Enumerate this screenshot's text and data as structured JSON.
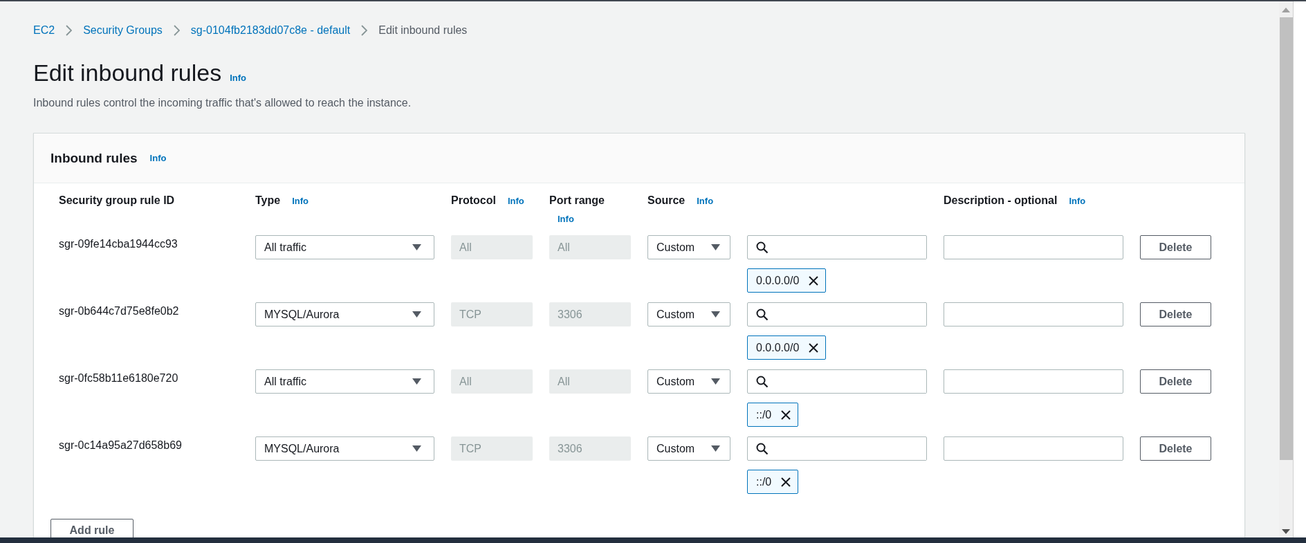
{
  "breadcrumb": [
    {
      "label": "EC2",
      "current": false
    },
    {
      "label": "Security Groups",
      "current": false
    },
    {
      "label": "sg-0104fb2183dd07c8e - default",
      "current": false
    },
    {
      "label": "Edit inbound rules",
      "current": true
    }
  ],
  "page": {
    "title": "Edit inbound rules",
    "info": "Info",
    "description": "Inbound rules control the incoming traffic that's allowed to reach the instance."
  },
  "panel": {
    "title": "Inbound rules",
    "info": "Info",
    "columns": [
      {
        "label": "Security group rule ID"
      },
      {
        "label": "Type",
        "info": "Info"
      },
      {
        "label": "Protocol",
        "info": "Info"
      },
      {
        "label": "Port range",
        "info": "Info",
        "info_below": true
      },
      {
        "label": "Source",
        "info": "Info"
      },
      {
        "label": "Description - optional",
        "info": "Info"
      }
    ],
    "rules": [
      {
        "id": "sgr-09fe14cba1944cc93",
        "type": "All traffic",
        "protocol": "All",
        "port_range": "All",
        "source": "Custom",
        "cidrs": [
          "0.0.0.0/0"
        ],
        "delete": "Delete"
      },
      {
        "id": "sgr-0b644c7d75e8fe0b2",
        "type": "MYSQL/Aurora",
        "protocol": "TCP",
        "port_range": "3306",
        "source": "Custom",
        "cidrs": [
          "0.0.0.0/0"
        ],
        "delete": "Delete"
      },
      {
        "id": "sgr-0fc58b11e6180e720",
        "type": "All traffic",
        "protocol": "All",
        "port_range": "All",
        "source": "Custom",
        "cidrs": [
          "::/0"
        ],
        "delete": "Delete"
      },
      {
        "id": "sgr-0c14a95a27d658b69",
        "type": "MYSQL/Aurora",
        "protocol": "TCP",
        "port_range": "3306",
        "source": "Custom",
        "cidrs": [
          "::/0"
        ],
        "delete": "Delete"
      }
    ],
    "add_button": "Add rule"
  }
}
